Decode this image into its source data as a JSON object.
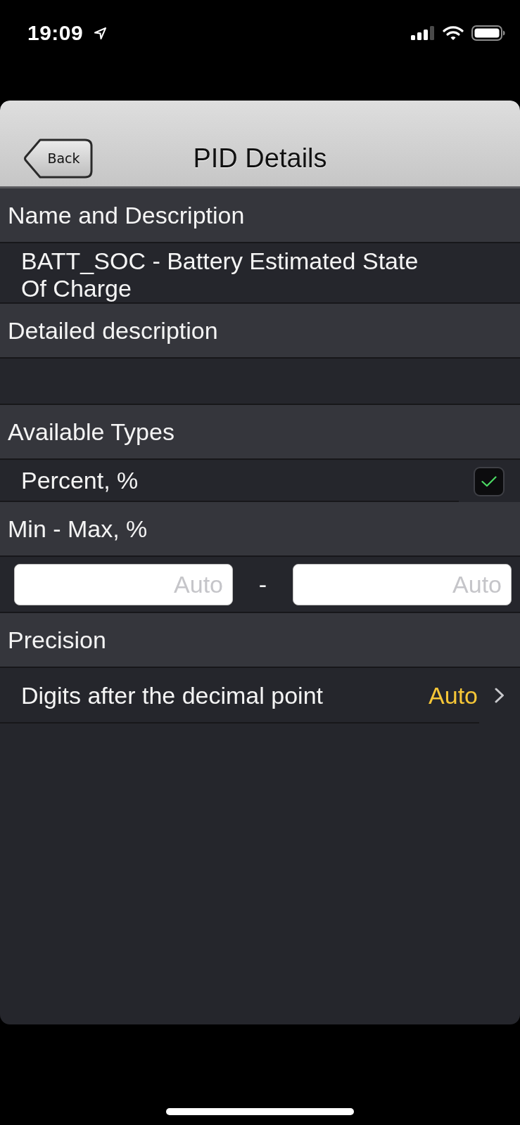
{
  "status_bar": {
    "time": "19:09"
  },
  "nav_bar": {
    "back_label": "Back",
    "title": "PID Details"
  },
  "sections": [
    {
      "header": "Name and Description",
      "rows": [
        {
          "kind": "text",
          "text": "BATT_SOC - Battery Estimated State Of Charge"
        }
      ]
    },
    {
      "header": "Detailed description",
      "rows": [
        {
          "kind": "blank"
        }
      ]
    },
    {
      "header": "Available Types",
      "rows": [
        {
          "kind": "checkbox",
          "label": "Percent, %",
          "checked": true
        }
      ]
    },
    {
      "header": "Min - Max, %",
      "rows": [
        {
          "kind": "range",
          "min": {
            "placeholder": "Auto"
          },
          "separator": "-",
          "max": {
            "placeholder": "Auto"
          }
        }
      ]
    },
    {
      "header": "Precision",
      "rows": [
        {
          "kind": "link",
          "label": "Digits after the decimal point",
          "value": "Auto"
        }
      ]
    }
  ]
}
